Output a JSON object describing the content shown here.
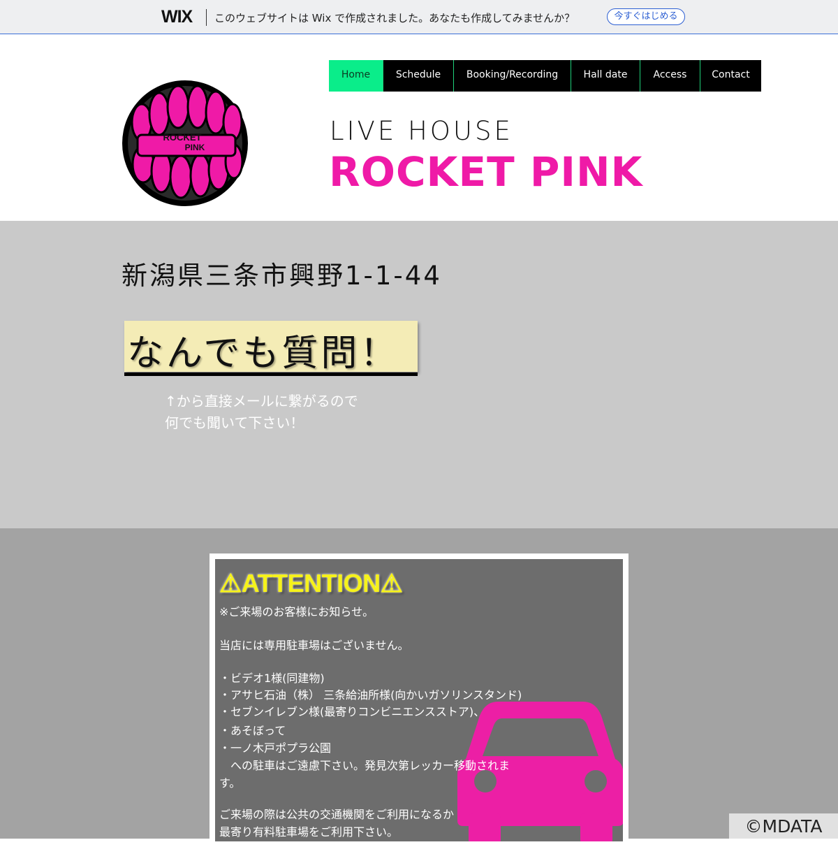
{
  "wix_banner": {
    "logo": "WIX",
    "message": "このウェブサイトは Wix で作成されました。あなたも作成してみませんか？",
    "cta": "今すぐはじめる"
  },
  "header": {
    "logo_text_top": "ROCKET",
    "logo_text_bottom": "PINK",
    "tagline": "LIVE HOUSE",
    "brand": "ROCKET PINK"
  },
  "nav": {
    "items": [
      {
        "label": "Home",
        "active": true
      },
      {
        "label": "Schedule"
      },
      {
        "label": "Booking/Recording"
      },
      {
        "label": "Hall date"
      },
      {
        "label": "Access"
      },
      {
        "label": "Contact"
      }
    ]
  },
  "contact_section": {
    "address": "新潟県三条市興野1-1-44",
    "ask_button": "なんでも質問！",
    "hint_line1": "↑から直接メールに繋がるので",
    "hint_line2": "何でも聞いて下さい！"
  },
  "attention": {
    "title": "⚠ATTENTION⚠",
    "lines": [
      "※ご来場のお客様にお知らせ。",
      "",
      "当店には専用駐車場はございません。",
      "",
      "・ビデオ1様(同建物)",
      "・アサヒ石油（株） 三条給油所様(向かいガソリンスタンド)",
      "・セブンイレブン様(最寄りコンビニエンスストア)、",
      "・あそぼって",
      "・一ノ木戸ポプラ公園",
      "　への駐車はご遠慮下さい。発見次第レッカー移動されま",
      "す。",
      "",
      "ご来場の際は公共の交通機関をご利用になるか",
      "最寄り有料駐車場をご利用下さい。"
    ]
  },
  "footer": {
    "copyright": "©MDATA"
  },
  "colors": {
    "brand_pink": "#ef1aa7",
    "nav_active": "#0aed8a",
    "attention_yellow": "#f6f21a"
  }
}
